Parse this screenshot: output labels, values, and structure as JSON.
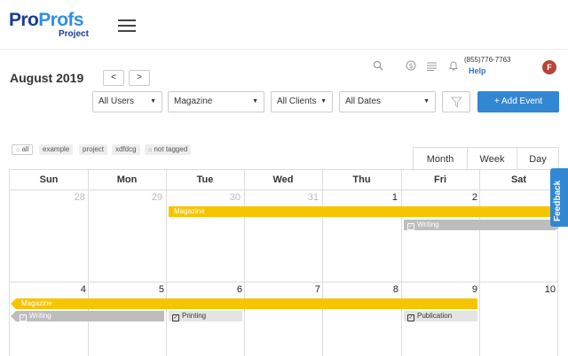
{
  "logo": {
    "part1": "Pro",
    "part2": "Profs",
    "sub": "Project"
  },
  "header": {
    "month_title": "August 2019",
    "prev": "<",
    "next": ">",
    "phone": "(855)776-7763",
    "help": "Help",
    "avatar": "F",
    "icons": [
      "search-icon",
      "dollar-icon",
      "list-icon",
      "bell-icon"
    ]
  },
  "filters": {
    "users": "All Users",
    "project": "Magazine",
    "clients": "All Clients",
    "dates": "All Dates",
    "add_event": "+ Add Event"
  },
  "tags": [
    "all",
    "example",
    "project",
    "xdfdcg",
    "not tagged"
  ],
  "views": [
    "Month",
    "Week",
    "Day"
  ],
  "calendar": {
    "weekdays": [
      "Sun",
      "Mon",
      "Tue",
      "Wed",
      "Thu",
      "Fri",
      "Sat"
    ],
    "week1": [
      "28",
      "29",
      "30",
      "31",
      "1",
      "2",
      ""
    ],
    "week2": [
      "4",
      "5",
      "6",
      "7",
      "8",
      "9",
      "10"
    ],
    "events": {
      "magazine1": "Magazine",
      "writing1": "Writing",
      "magazine2": "Magazine",
      "writing2": "Writing",
      "printing": "Printing",
      "publication": "Publication"
    }
  },
  "feedback": "Feedback",
  "colors": {
    "accent": "#3287d2",
    "event_yellow": "#f7c500",
    "event_gray": "#bdbdbd",
    "avatar": "#b5443a"
  }
}
